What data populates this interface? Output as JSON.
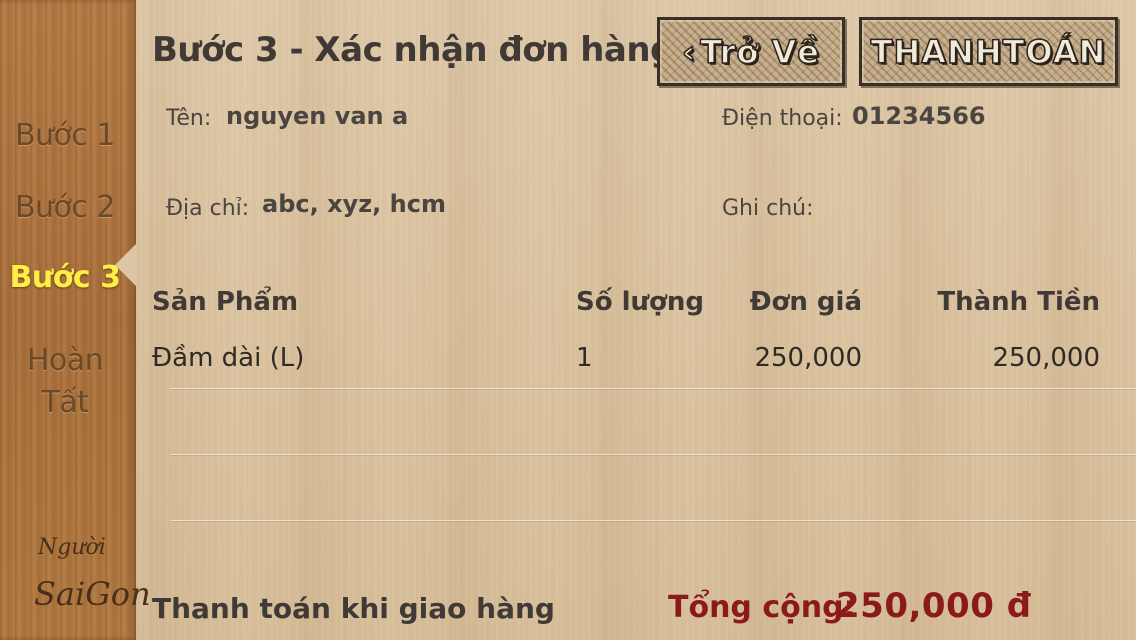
{
  "sidebar": {
    "steps": [
      {
        "label": "Bước 1"
      },
      {
        "label": "Bước 2"
      },
      {
        "label": "Bước 3"
      },
      {
        "label_line1": "Hoàn",
        "label_line2": "Tất"
      }
    ],
    "active_step": 3,
    "logo": {
      "line1": "Người",
      "line2": "SaiGon"
    }
  },
  "header": {
    "title": "Bước 3 - Xác nhận đơn hàng",
    "back_label": "Trở Về",
    "pay_label": "THANHTOÁN"
  },
  "customer": {
    "name_label": "Tên:",
    "name_value": "nguyen van a",
    "phone_label": "Điện thoại:",
    "phone_value": "01234566",
    "address_label": "Địa chỉ:",
    "address_value": "abc, xyz, hcm",
    "note_label": "Ghi chú:",
    "note_value": ""
  },
  "order_table": {
    "headers": [
      "Sản Phẩm",
      "Số lượng",
      "Đơn giá",
      "Thành Tiền"
    ],
    "rows": [
      {
        "product": "Đầm dài (L)",
        "quantity": "1",
        "unit_price": "250,000",
        "line_total": "250,000"
      }
    ]
  },
  "footer": {
    "payment_method": "Thanh toán khi giao hàng",
    "total_label": "Tổng cộng:",
    "total_value": "250,000 đ"
  },
  "colors": {
    "active_step": "#ffee44",
    "total": "#8b1a1a",
    "wood_sidebar": "#a86f3c",
    "wood_main": "#d9c09c"
  }
}
